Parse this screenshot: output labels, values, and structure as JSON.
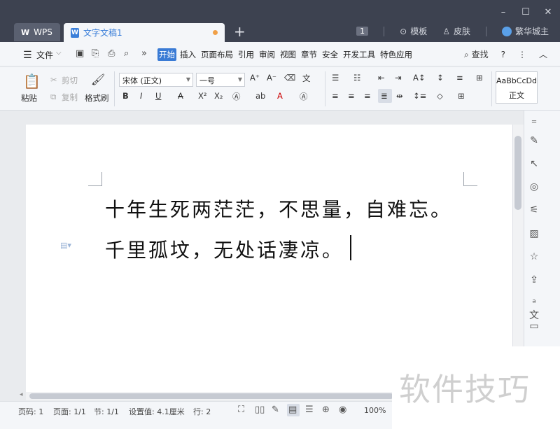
{
  "window": {
    "app_tab": "WPS",
    "document_tab": "文字文稿1",
    "new_tab": "+",
    "controls": [
      "–",
      "☐",
      "✕"
    ],
    "title_right": {
      "badge": "1",
      "template": "模板",
      "skin": "皮肤",
      "user": "繁华城主"
    }
  },
  "menubar": {
    "file": "文件",
    "more": "»",
    "tabs": [
      "开始",
      "插入",
      "页面布局",
      "引用",
      "审阅",
      "视图",
      "章节",
      "安全",
      "开发工具",
      "特色应用"
    ],
    "active_tab": "开始",
    "search": "查找",
    "help": "?"
  },
  "ribbon": {
    "paste": "粘贴",
    "cut": "剪切",
    "copy": "复制",
    "format_painter": "格式刷",
    "font_name": "宋体 (正文)",
    "font_size": "一号",
    "bold": "B",
    "italic": "I",
    "underline": "U",
    "strike": "A",
    "superscript": "X²",
    "subscript": "X₂",
    "style_sample": "AaBbCcDd",
    "style_name": "正文",
    "accent_color": "#3a7bd5"
  },
  "document": {
    "lines": [
      "十年生死两茫茫，不思量，自难忘。",
      "千里孤坟，无处话凄凉。"
    ]
  },
  "statusbar": {
    "page_code": "页码: 1",
    "page": "页面: 1/1",
    "section": "节: 1/1",
    "setting": "设置值: 4.1厘米",
    "row": "行: 2",
    "zoom": "100%"
  },
  "watermark": "软件技巧"
}
